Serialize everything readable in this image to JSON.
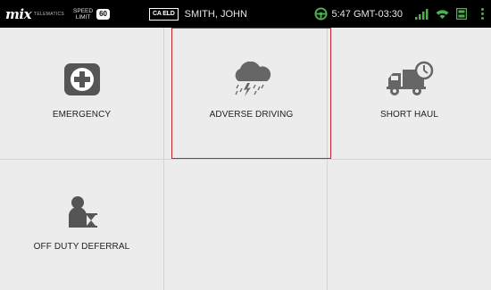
{
  "status_bar": {
    "logo_text": "mix",
    "logo_sub": "TELEMATICS",
    "speed_limit_label_1": "SPEED",
    "speed_limit_label_2": "LIMIT",
    "speed_limit_value": "60",
    "eld_badge": "CA ELD",
    "driver_name": "SMITH, JOHN",
    "time": "5:47 GMT-03:30",
    "icons": [
      "steering-wheel-icon",
      "signal-icon",
      "wifi-icon",
      "storage-icon",
      "menu-icon"
    ],
    "accent_color": "#4caf50"
  },
  "tiles": [
    {
      "label": "EMERGENCY",
      "icon": "first-aid-icon",
      "selected": false
    },
    {
      "label": "ADVERSE DRIVING",
      "icon": "storm-cloud-icon",
      "selected": true
    },
    {
      "label": "SHORT HAUL",
      "icon": "truck-clock-icon",
      "selected": false
    },
    {
      "label": "OFF DUTY DEFERRAL",
      "icon": "person-hourglass-icon",
      "selected": false
    }
  ],
  "colors": {
    "tile_background": "#ececec",
    "selection_border": "#c1272d",
    "icon_color": "#555555"
  }
}
